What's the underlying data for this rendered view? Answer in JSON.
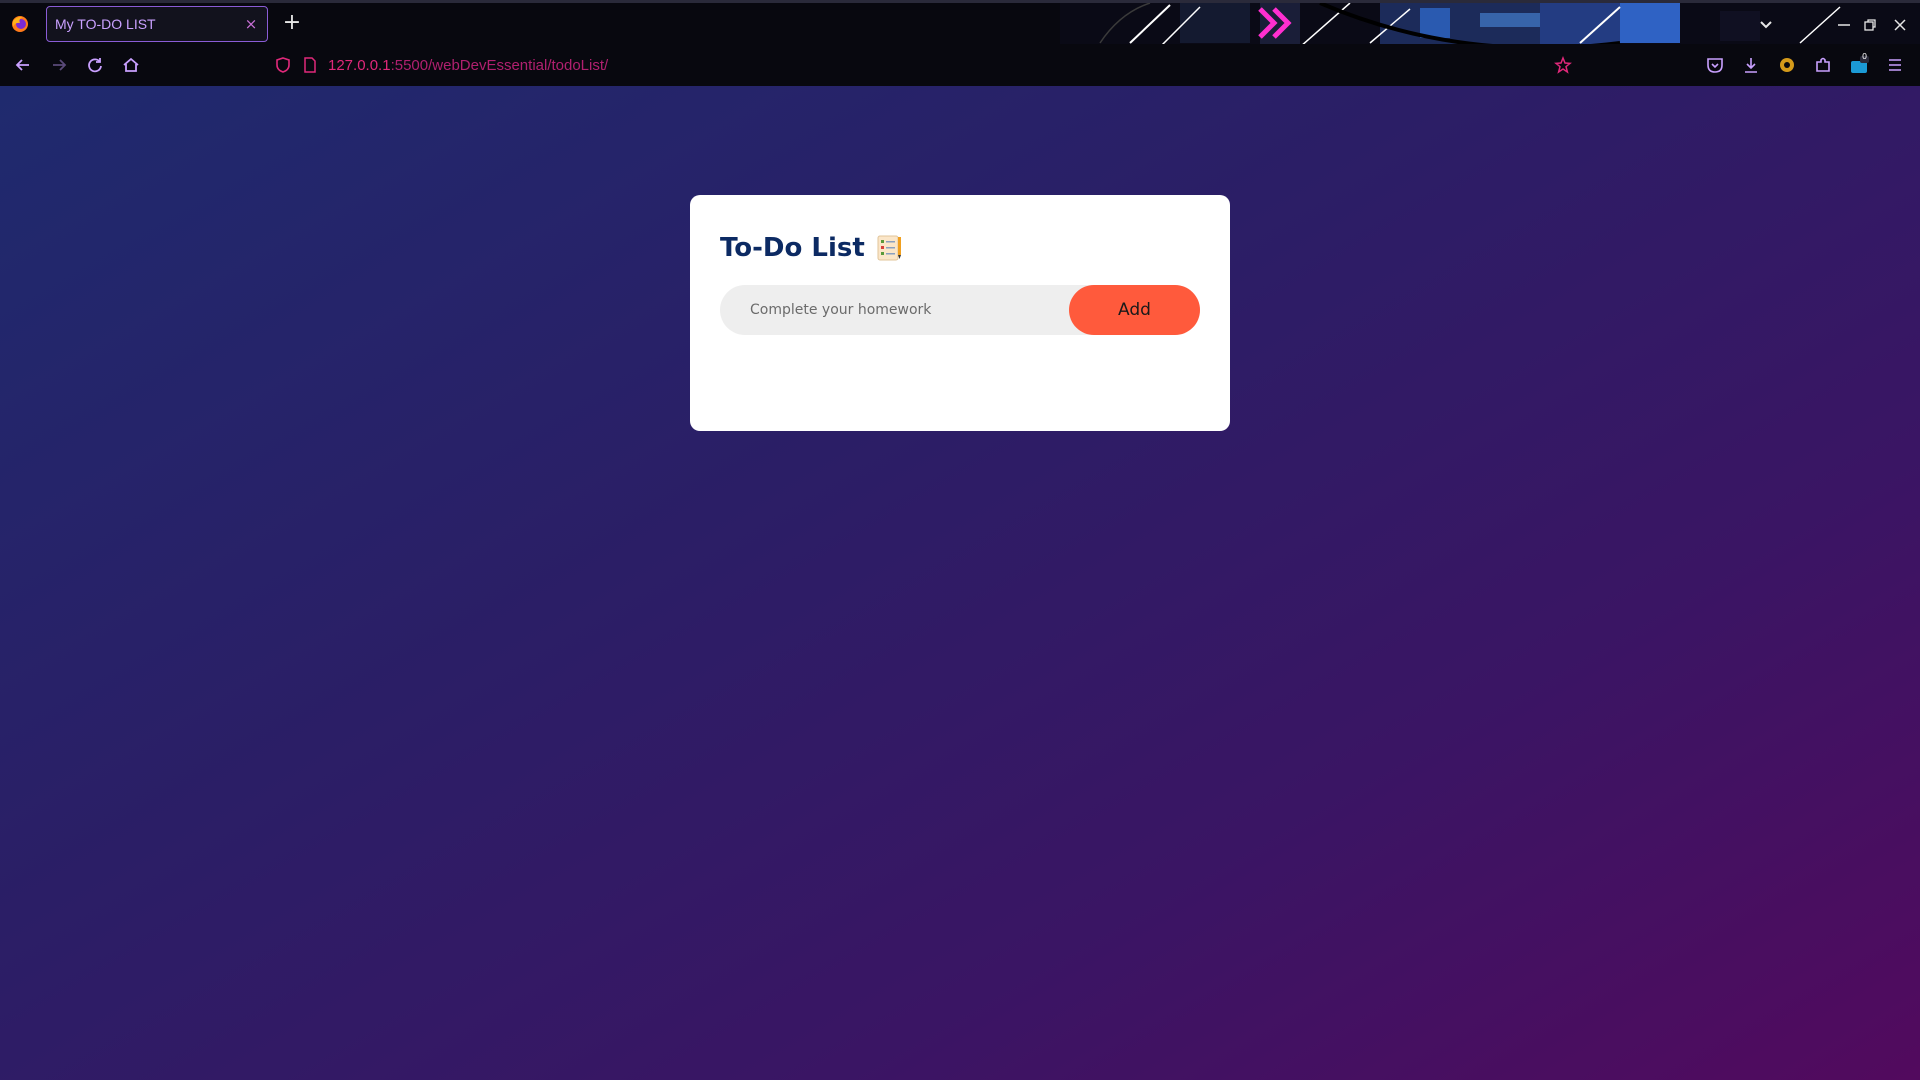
{
  "browser": {
    "tab": {
      "title": "My TO-DO LIST",
      "close_glyph": "×"
    },
    "new_tab_glyph": "+",
    "url": {
      "host": "127.0.0.1",
      "path": ":5500/webDevEssential/todoList/"
    },
    "icons": [
      "firefox-logo-icon",
      "list-all-tabs-icon",
      "minimize-icon",
      "maximize-icon",
      "close-window-icon",
      "back-icon",
      "forward-icon",
      "reload-icon",
      "home-icon",
      "shield-icon",
      "page-icon",
      "bookmark-star-icon",
      "pocket-icon",
      "downloads-icon",
      "extension-gear-icon",
      "extensions-puzzle-icon",
      "account-badge-icon",
      "menu-icon"
    ],
    "badge_count": "0",
    "accent_color": "#e0287a"
  },
  "app": {
    "title": "To-Do List",
    "input_placeholder": "Complete your homework",
    "input_value": "",
    "add_button_label": "Add",
    "items": [],
    "colors": {
      "card_bg": "#ffffff",
      "title": "#0c2a63",
      "input_bg": "#eeeeee",
      "button_bg": "#ff5a3c",
      "gradient_start": "#1f2a6e",
      "gradient_end": "#520a5e"
    }
  }
}
